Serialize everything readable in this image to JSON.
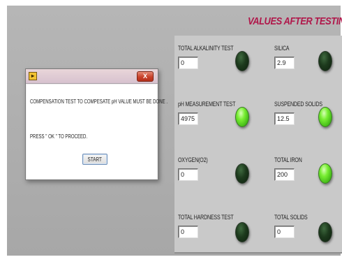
{
  "header": {
    "title": "VALUES AFTER TESTING"
  },
  "tests": [
    {
      "label": "TOTAL ALKALINITY TEST",
      "value": "0",
      "indicator": "off"
    },
    {
      "label": "SILICA",
      "value": "2.9",
      "indicator": "off"
    },
    {
      "label": "pH MEASUREMENT TEST",
      "value": "4975",
      "indicator": "on"
    },
    {
      "label": "SUSPENDED SOLIDS",
      "value": "12.5",
      "indicator": "on"
    },
    {
      "label": "OXYGEN(O2)",
      "value": "0",
      "indicator": "off"
    },
    {
      "label": "TOTAL IRON",
      "value": "200",
      "indicator": "on"
    },
    {
      "label": "TOTAL HARDNESS TEST",
      "value": "0",
      "indicator": "off"
    },
    {
      "label": "TOTAL SOLIDS",
      "value": "0",
      "indicator": "off"
    }
  ],
  "dialog": {
    "close_label": "X",
    "message": "COMPENSATION TEST TO COMPESATE pH VALUE MUST BE DONE .",
    "instruction": "PRESS \" OK \" TO PROCEED.",
    "button_label": "START"
  },
  "colors": {
    "title": "#b0174a",
    "led_on": "#79ee33",
    "led_off": "#1d3a1d",
    "panel_background": "#b6b6b6"
  }
}
